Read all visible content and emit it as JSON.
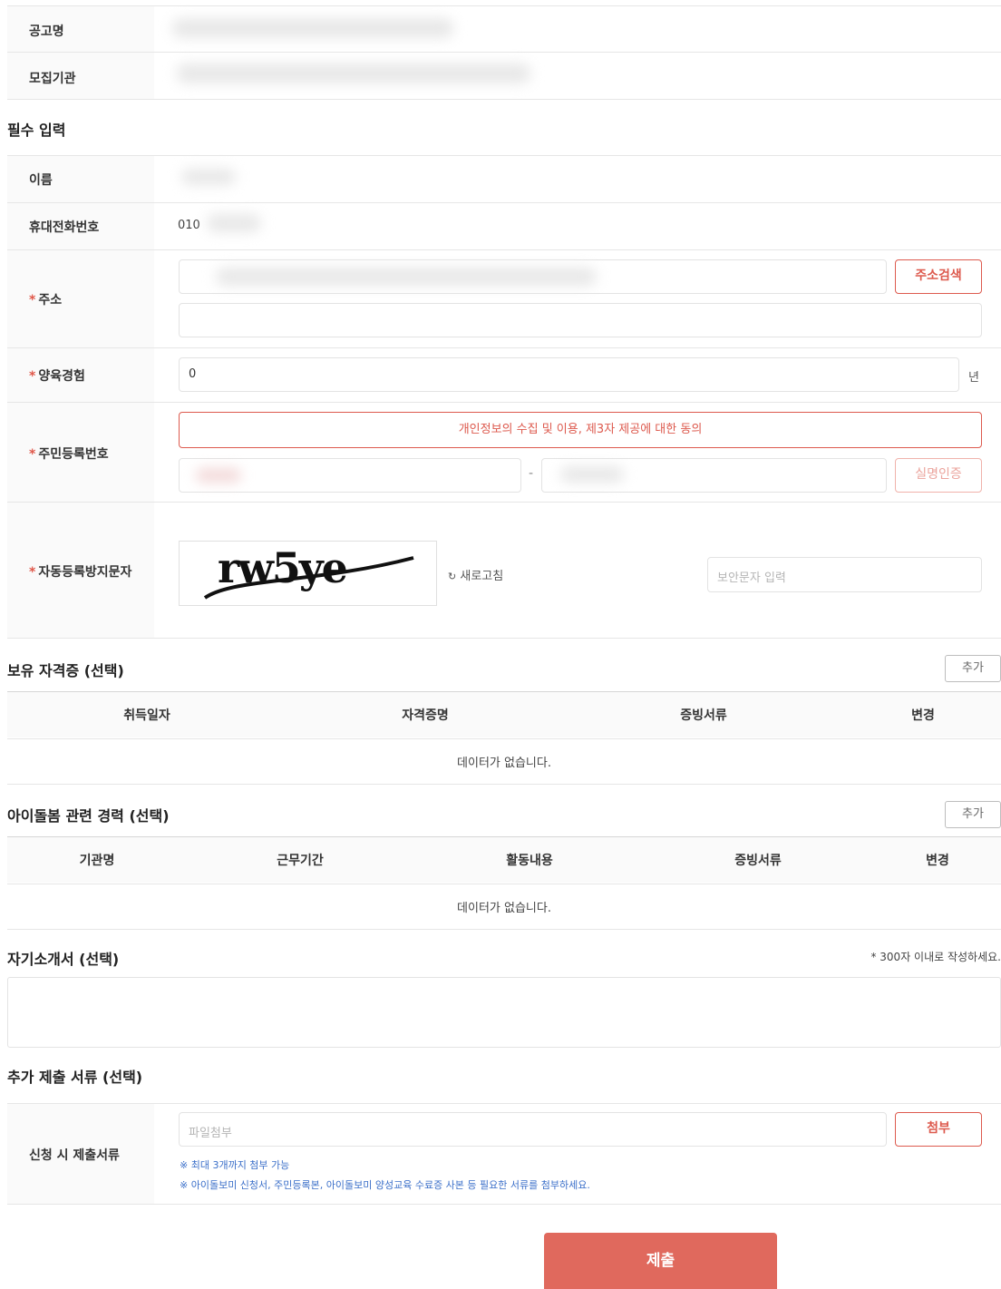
{
  "info": {
    "announcement_label": "공고명",
    "agency_label": "모집기관"
  },
  "required_section": {
    "title": "필수 입력",
    "name_label": "이름",
    "phone_label": "휴대전화번호",
    "phone_value": "010",
    "address_label": "주소",
    "address_search_button": "주소검색",
    "experience_label": "양육경험",
    "experience_value": "0",
    "experience_unit": "년",
    "resident_label": "주민등록번호",
    "consent_button": "개인정보의 수집 및 이용, 제3자 제공에 대한 동의",
    "resident_separator": "-",
    "verify_button": "실명인증",
    "captcha_label": "자동등록방지문자",
    "captcha_text": "rw5ye",
    "refresh_label": "새로고침",
    "captcha_placeholder": "보안문자 입력"
  },
  "certificates": {
    "title": "보유 자격증 (선택)",
    "add_button": "추가",
    "columns": [
      "취득일자",
      "자격증명",
      "증빙서류",
      "변경"
    ],
    "empty": "데이터가 없습니다."
  },
  "careers": {
    "title": "아이돌봄 관련 경력 (선택)",
    "add_button": "추가",
    "columns": [
      "기관명",
      "근무기간",
      "활동내용",
      "증빙서류",
      "변경"
    ],
    "empty": "데이터가 없습니다."
  },
  "intro": {
    "title": "자기소개서 (선택)",
    "note": "* 300자 이내로 작성하세요."
  },
  "documents": {
    "title": "추가 제출 서류 (선택)",
    "label": "신청 시 제출서류",
    "file_placeholder": "파일첨부",
    "attach_button": "첨부",
    "note1": "※ 최대 3개까지 첨부 가능",
    "note2": "※ 아이돌보미 신청서, 주민등록본, 아이돌보미 양성교육 수료증 사본 등 필요한 서류를 첨부하세요."
  },
  "submit_button": "제출",
  "colors": {
    "accent": "#dd5a4e",
    "submit": "#e0695d",
    "note": "#3b6fc9"
  }
}
